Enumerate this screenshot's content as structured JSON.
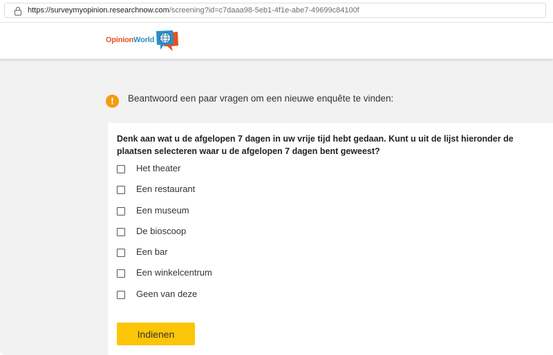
{
  "browser": {
    "url_host": "https://surveymyopinion.researchnow.com",
    "url_path": "/screening?id=c7daaa98-5eb1-4f1e-abe7-49699c84100f"
  },
  "header": {
    "logo_part1": "Opinion",
    "logo_part2": "World",
    "logo_icon": "globe-speech-bubbles-icon",
    "colors": {
      "opinion": "#e2531f",
      "world": "#2a8fc9"
    }
  },
  "notice": {
    "icon": "exclamation-icon",
    "icon_color": "#f39c12",
    "text": "Beantwoord een paar vragen om een nieuwe enquête te vinden:"
  },
  "question": {
    "text": "Denk aan wat u de afgelopen 7 dagen in uw vrije tijd hebt gedaan. Kunt u uit de lijst hieronder de plaatsen selecteren waar u de afgelopen 7 dagen bent geweest?",
    "options": [
      {
        "label": "Het theater",
        "checked": false
      },
      {
        "label": "Een restaurant",
        "checked": false
      },
      {
        "label": "Een museum",
        "checked": false
      },
      {
        "label": "De bioscoop",
        "checked": false
      },
      {
        "label": "Een bar",
        "checked": false
      },
      {
        "label": "Een winkelcentrum",
        "checked": false
      },
      {
        "label": "Geen van deze",
        "checked": false
      }
    ]
  },
  "submit": {
    "label": "Indienen",
    "color": "#fdc507"
  }
}
